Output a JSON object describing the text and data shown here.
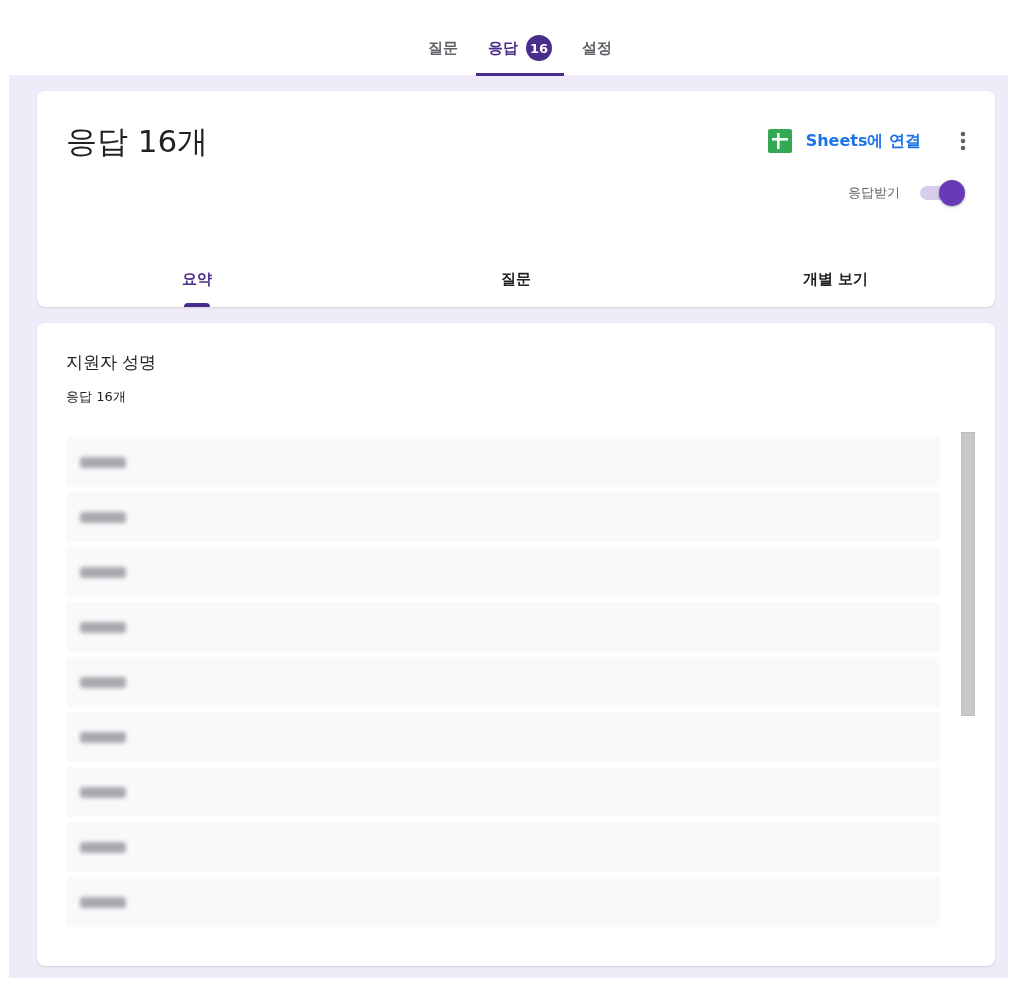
{
  "top_tabs": [
    {
      "label": "질문",
      "selected": false
    },
    {
      "label": "응답",
      "selected": true,
      "badge": "16"
    },
    {
      "label": "설정",
      "selected": false
    }
  ],
  "summary_card": {
    "title": "응답 16개",
    "sheets_link": "Sheets에 연결",
    "accepting_responses": {
      "label": "응답받기",
      "on": true
    },
    "tabs": [
      {
        "label": "요약",
        "selected": true
      },
      {
        "label": "질문",
        "selected": false
      },
      {
        "label": "개별 보기",
        "selected": false
      }
    ]
  },
  "question": {
    "title": "지원자 성명",
    "count": "응답 16개",
    "answers": [
      {
        "redacted": true
      },
      {
        "redacted": true
      },
      {
        "redacted": true
      },
      {
        "redacted": true
      },
      {
        "redacted": true
      },
      {
        "redacted": true
      },
      {
        "redacted": true
      },
      {
        "redacted": true
      },
      {
        "redacted": true
      }
    ]
  }
}
